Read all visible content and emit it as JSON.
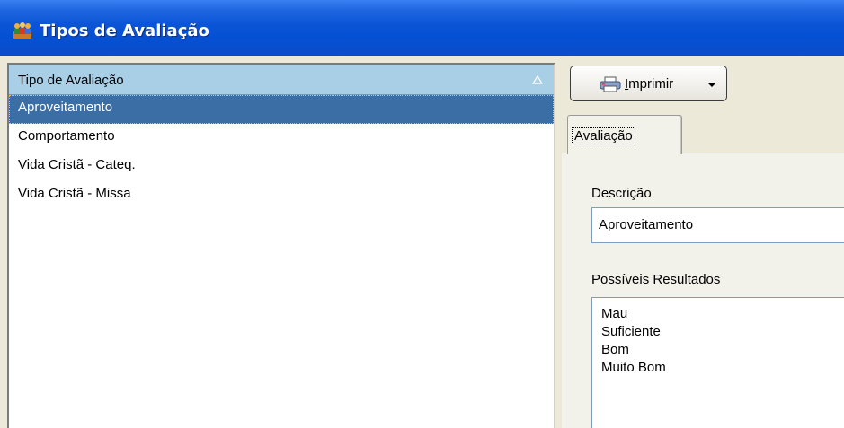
{
  "window": {
    "title": "Tipos de Avaliação",
    "icon": "people-group-icon",
    "title_bar_color": "#0a54d6"
  },
  "list": {
    "column_header": "Tipo de Avaliação",
    "sort": "ascending",
    "items": [
      {
        "label": "Aproveitamento",
        "selected": true
      },
      {
        "label": "Comportamento",
        "selected": false
      },
      {
        "label": "Vida Cristã - Cateq.",
        "selected": false
      },
      {
        "label": "Vida Cristã - Missa",
        "selected": false
      }
    ],
    "selection_color": "#3a6ea5",
    "header_color": "#a9cfe6"
  },
  "toolbar": {
    "print_icon": "printer-icon",
    "print_label_mnemonic": "I",
    "print_label_rest": "mprimir"
  },
  "tabs": [
    {
      "label": "Avaliação",
      "active": true
    }
  ],
  "form": {
    "descricao_label": "Descrição",
    "descricao_value": "Aproveitamento",
    "resultados_label": "Possíveis Resultados",
    "resultados": [
      "Mau",
      "Suficiente",
      "Bom",
      "Muito Bom"
    ]
  }
}
